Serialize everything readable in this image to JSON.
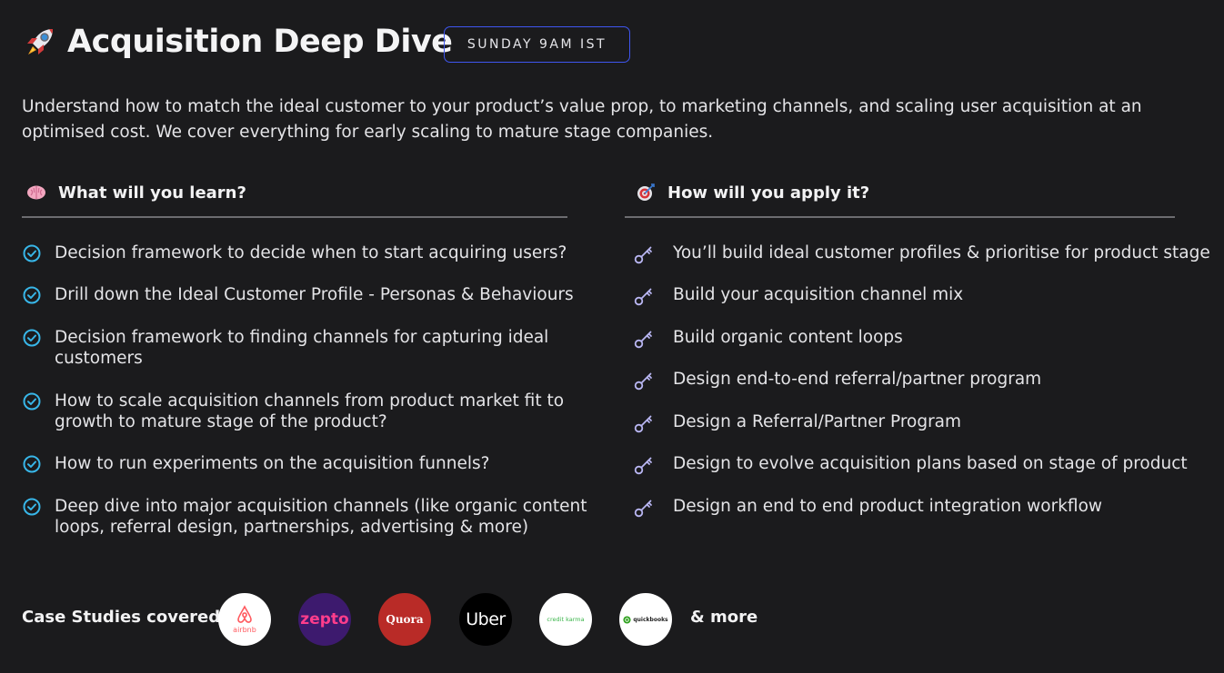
{
  "header": {
    "title": "Acquisition Deep Dive",
    "badge": "SUNDAY 9AM IST",
    "rocket_icon": "rocket-icon"
  },
  "description": "Understand how to match the ideal customer to your product’s value prop, to marketing channels, and scaling user acquisition at an optimised cost. We cover everything for early scaling to mature stage companies.",
  "learn": {
    "heading": "What will you learn?",
    "icon": "brain-icon",
    "items": [
      "Decision framework to decide when to start acquiring users?",
      "Drill down the Ideal Customer Profile -  Personas & Behaviours",
      "Decision framework to finding channels for capturing ideal customers",
      "How to scale acquisition channels from product market fit to growth to mature stage of the product?",
      "How to run experiments on the acquisition funnels?",
      "Deep dive into major acquisition channels (like organic content loops, referral design, partnerships, advertising & more)"
    ]
  },
  "apply": {
    "heading": "How will you apply it?",
    "icon": "target-icon",
    "items": [
      "You’ll build ideal customer profiles & prioritise for product stage",
      "Build your acquisition channel mix",
      "Build organic content loops",
      "Design end-to-end referral/partner program",
      "Design a Referral/Partner Program",
      "Design to evolve acquisition plans based on stage of product",
      "Design an end to end product integration workflow"
    ]
  },
  "case_studies": {
    "label": "Case Studies covered:",
    "more": "& more",
    "logos": [
      {
        "name": "airbnb",
        "text": "airbnb",
        "bg": "#ffffff",
        "color": "#ff5a5f"
      },
      {
        "name": "zepto",
        "text": "zepto",
        "bg": "#3d1a6e",
        "color": "#ff3d8b"
      },
      {
        "name": "quora",
        "text": "Quora",
        "bg": "#b92b27",
        "color": "#ffffff"
      },
      {
        "name": "uber",
        "text": "Uber",
        "bg": "#000000",
        "color": "#ffffff"
      },
      {
        "name": "credit-karma",
        "text": "credit karma",
        "bg": "#ffffff",
        "color": "#3ab54a"
      },
      {
        "name": "quickbooks",
        "text": "quickbooks",
        "bg": "#ffffff",
        "color": "#222222"
      }
    ]
  },
  "colors": {
    "background": "#1b1b1d",
    "badge_border": "#3f56f0",
    "check": "#38b6e8",
    "key": "#b9b6f2"
  }
}
